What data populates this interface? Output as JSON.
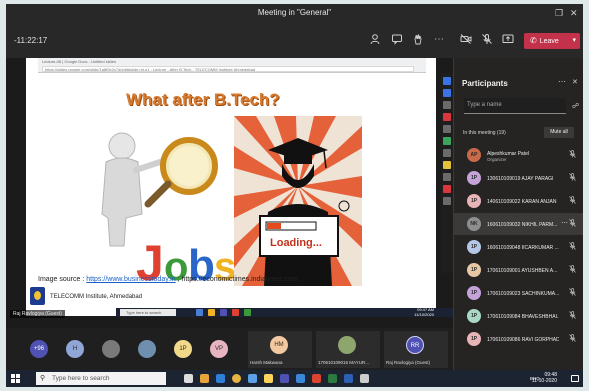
{
  "window": {
    "title": "Meeting in \"General\"",
    "controls": [
      "minimize-restore",
      "close"
    ]
  },
  "toolbar": {
    "timer": "-11:22:17",
    "icons": [
      "participants-icon",
      "chat-icon",
      "raise-hand-icon",
      "more-icon",
      "camera-off-icon",
      "mic-off-icon",
      "share-icon"
    ],
    "leave_label": "Leave"
  },
  "shared_screen": {
    "tab_text": "Lecture-08 | Google Docs - Untitled slides",
    "address": "https://slides.google.com/slide/1a8f0e2c7d/edit#slide=id.p1 - Lecture - After B.Tech - TELECOMM Institute Ahmedabad",
    "heading": "What after B.Tech?",
    "jobs_word": [
      "J",
      "o",
      "b",
      "s"
    ],
    "poster_text": "Loading...",
    "source_prefix": "Image source : ",
    "source_link": "https://www.businesstoday.in",
    "source_suffix": " ; https://economictimes.indiatimes.com",
    "institute": "TELECOMM Institute, Ahmedabad",
    "inner_search": "Type here to search",
    "inner_clock_time": "09:47 AM",
    "inner_clock_date": "11/10/2020",
    "presenter_tag": "Raj Ravlogiya (Guest)"
  },
  "participants": {
    "title": "Participants",
    "search_placeholder": "Type a name",
    "section": "In this meeting (19)",
    "mute_all": "Mute all",
    "rows": [
      {
        "initials": "AP",
        "name": "Alpeshkumar Patel",
        "role": "Organizer",
        "color": "#c96a4a"
      },
      {
        "initials": "1P",
        "name": "130610109019 AJAY PARAGI",
        "role": "",
        "color": "#c5a3d9"
      },
      {
        "initials": "1P",
        "name": "140610109022 KARAN ANJAN",
        "role": "",
        "color": "#e8b4b8"
      },
      {
        "initials": "NK",
        "name": "160610109032 NIKHIL PARM...",
        "role": "",
        "color": "#8e8e8e"
      },
      {
        "initials": "1P",
        "name": "160610109048 IICARKUMAR ...",
        "role": "",
        "color": "#b4c7e8"
      },
      {
        "initials": "1P",
        "name": "170610109001 AYUSHBEN A...",
        "role": "",
        "color": "#e8c8a4"
      },
      {
        "initials": "1P",
        "name": "170610109023 SACHINKUMA...",
        "role": "",
        "color": "#c5a3d9"
      },
      {
        "initials": "1P",
        "name": "170610109084 BHAVESHBHAI...",
        "role": "",
        "color": "#a9d8c7"
      },
      {
        "initials": "1P",
        "name": "170610109086 RAVI GORPHAD",
        "role": "",
        "color": "#e8b4b8"
      }
    ]
  },
  "strip": {
    "overflow": "+96",
    "bubbles": [
      {
        "label": "+96",
        "color": "#4f52b2"
      },
      {
        "label": "H",
        "color": "#8fa6d6"
      },
      {
        "label": "",
        "color": "#7a7a7a"
      },
      {
        "label": "",
        "color": "#6f8fb0"
      },
      {
        "label": "1P",
        "color": "#f2d98a"
      },
      {
        "label": "VP",
        "color": "#e8b4c2"
      }
    ],
    "tiles": [
      {
        "initials": "HM",
        "label": "Harsh Makwana",
        "color": "#f2c9a0"
      },
      {
        "initials": "",
        "label": "170610109016 MAYUR...",
        "color": "#8fa56e"
      },
      {
        "initials": "RR",
        "label": "Raj Ravlogiya (Guest)",
        "color": "#4f52b2"
      }
    ]
  },
  "taskbar": {
    "search": "Type here to search",
    "lang": "ENG",
    "time": "09:48",
    "date": "11-10-2020"
  },
  "colors": {
    "leave": "#c4314b",
    "accent": "#4f52b2",
    "heading": "#d87a2e"
  }
}
